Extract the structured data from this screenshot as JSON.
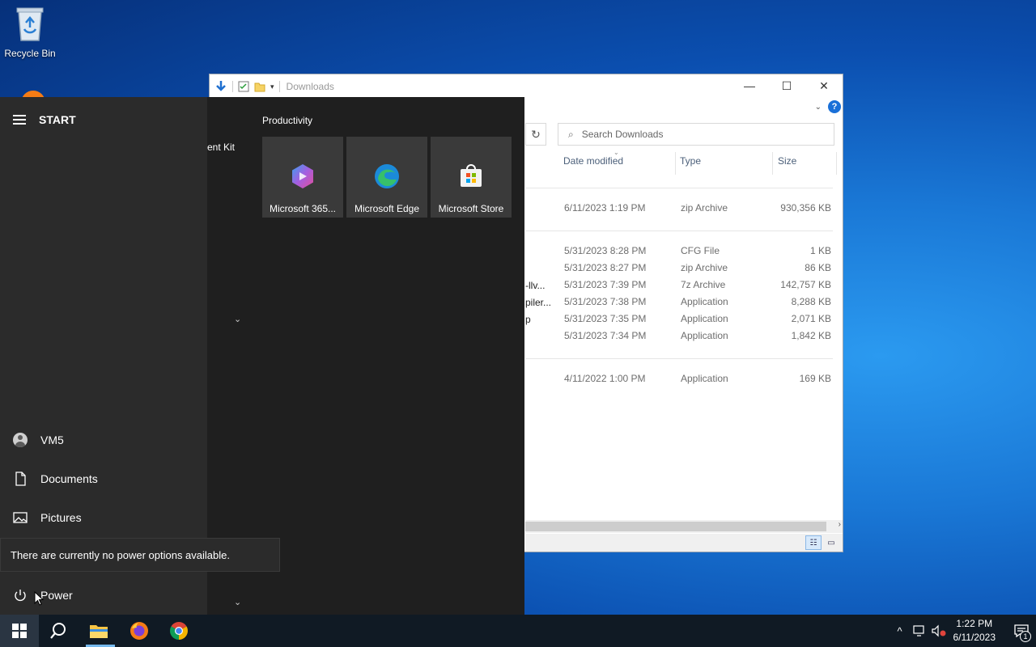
{
  "desktop": {
    "recycle_bin_label": "Recycle Bin"
  },
  "explorer": {
    "title": "Downloads",
    "search_placeholder": "Search Downloads",
    "help_glyph": "?",
    "columns": {
      "date": "Date modified",
      "type": "Type",
      "size": "Size"
    },
    "name_fragments": [
      "-llv...",
      "piler...",
      "p"
    ],
    "rows": [
      {
        "date": "6/11/2023 1:19 PM",
        "type": "zip Archive",
        "size": "930,356 KB"
      },
      {
        "date": "5/31/2023 8:28 PM",
        "type": "CFG File",
        "size": "1 KB"
      },
      {
        "date": "5/31/2023 8:27 PM",
        "type": "zip Archive",
        "size": "86 KB"
      },
      {
        "date": "5/31/2023 7:39 PM",
        "type": "7z Archive",
        "size": "142,757 KB"
      },
      {
        "date": "5/31/2023 7:38 PM",
        "type": "Application",
        "size": "8,288 KB"
      },
      {
        "date": "5/31/2023 7:35 PM",
        "type": "Application",
        "size": "2,071 KB"
      },
      {
        "date": "5/31/2023 7:34 PM",
        "type": "Application",
        "size": "1,842 KB"
      },
      {
        "date": "4/11/2022 1:00 PM",
        "type": "Application",
        "size": "169 KB"
      }
    ]
  },
  "start_menu": {
    "header": "START",
    "partial_app_label": "ent Kit",
    "group_label": "Productivity",
    "tiles": [
      {
        "label": "Microsoft 365..."
      },
      {
        "label": "Microsoft Edge"
      },
      {
        "label": "Microsoft Store"
      }
    ],
    "side_items": {
      "user": "VM5",
      "documents": "Documents",
      "pictures": "Pictures",
      "power": "Power"
    },
    "power_tooltip": "There are currently no power options available."
  },
  "taskbar": {
    "time": "1:22 PM",
    "date": "6/11/2023",
    "notification_count": "1"
  }
}
